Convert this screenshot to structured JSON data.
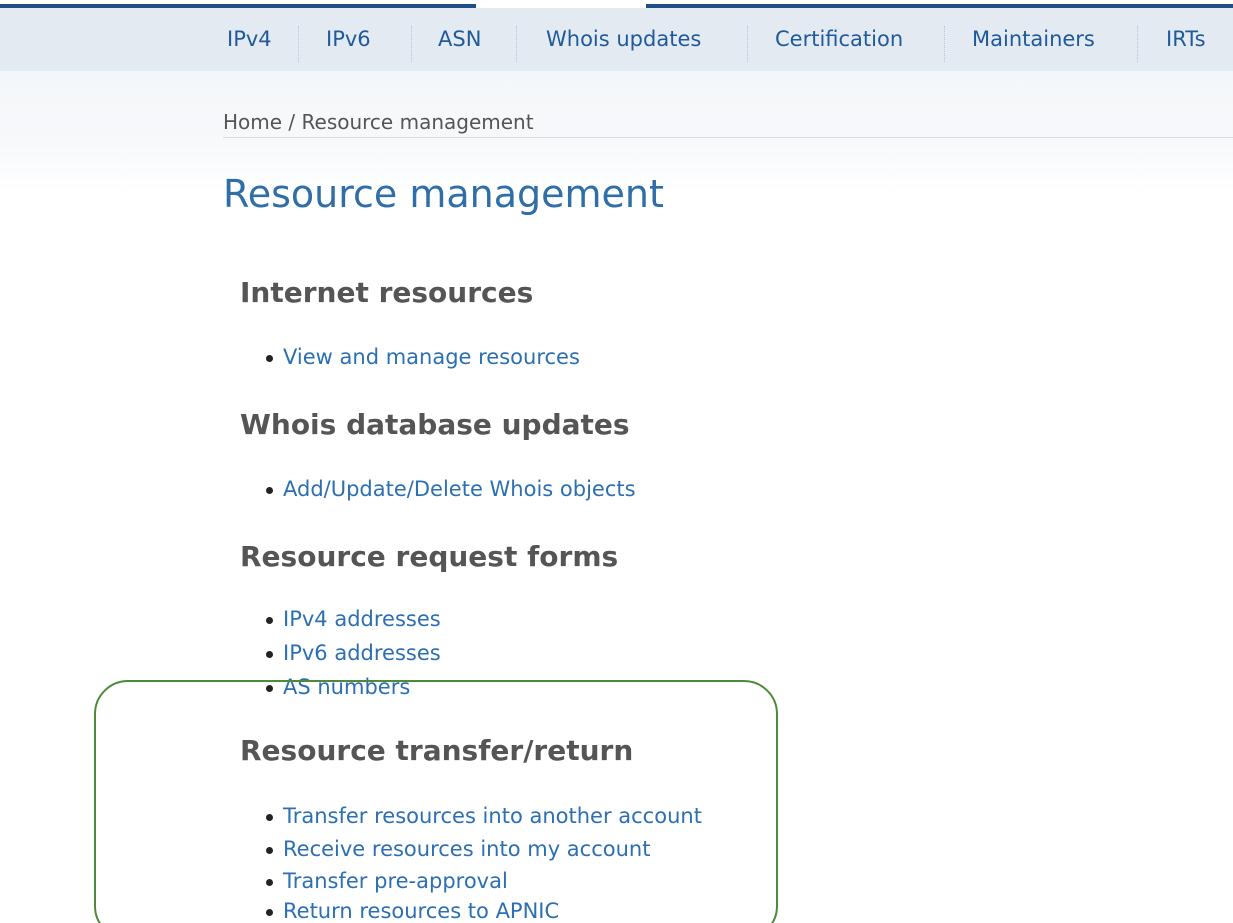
{
  "nav": {
    "items": [
      {
        "label": "IPv4"
      },
      {
        "label": "IPv6"
      },
      {
        "label": "ASN"
      },
      {
        "label": "Whois updates"
      },
      {
        "label": "Certification"
      },
      {
        "label": "Maintainers"
      },
      {
        "label": "IRTs"
      }
    ]
  },
  "breadcrumb": "Home / Resource management",
  "page_title": "Resource management",
  "sections": [
    {
      "heading": "Internet resources",
      "links": [
        "View and manage resources"
      ]
    },
    {
      "heading": "Whois database updates",
      "links": [
        "Add/Update/Delete Whois objects"
      ]
    },
    {
      "heading": "Resource request forms",
      "links": [
        "IPv4 addresses",
        "IPv6 addresses",
        "AS numbers"
      ]
    },
    {
      "heading": "Resource transfer/return",
      "links": [
        "Transfer resources into another account",
        "Receive resources into my account",
        "Transfer pre-approval",
        "Return resources to APNIC"
      ]
    }
  ],
  "colors": {
    "nav_background": "#e3eaf2",
    "link": "#2c6fb2",
    "title": "#2f6ea7",
    "heading": "#555555",
    "highlight_border": "#4e8a3a"
  }
}
